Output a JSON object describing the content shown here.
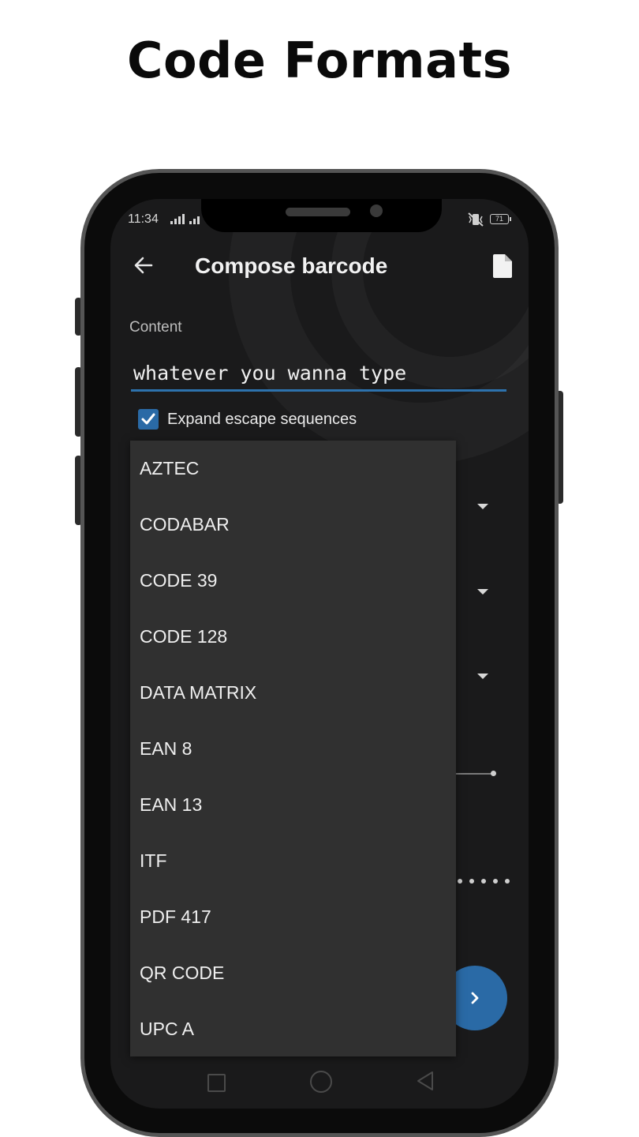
{
  "promo": {
    "title": "Code Formats"
  },
  "status_bar": {
    "time": "11:34",
    "battery": "71"
  },
  "appbar": {
    "title": "Compose barcode",
    "back_icon": "arrow-left-icon",
    "action_icon": "file-icon"
  },
  "form": {
    "content_label": "Content",
    "content_value": "whatever you wanna type",
    "expand_escape_label": "Expand escape sequences",
    "expand_escape_checked": true
  },
  "format_menu": {
    "items": [
      "AZTEC",
      "CODABAR",
      "CODE 39",
      "CODE 128",
      "DATA MATRIX",
      "EAN 8",
      "EAN 13",
      "ITF",
      "PDF 417",
      "QR CODE",
      "UPC A"
    ]
  },
  "fab": {
    "icon": "chevron-right-icon"
  },
  "colors": {
    "accent": "#2a6aa6",
    "background": "#1a1a1b",
    "menu": "#303030"
  }
}
